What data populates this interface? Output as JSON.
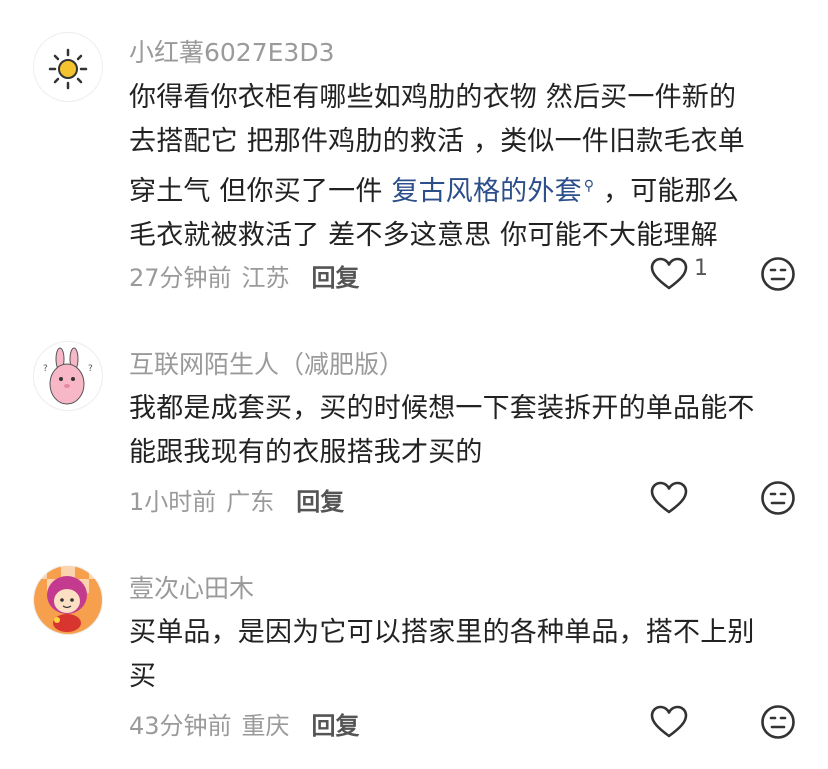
{
  "comments": [
    {
      "username": "小红薯6027E3D3",
      "avatar_icon": "sun-icon",
      "lines": [
        "你得看你衣柜有哪些如鸡肋的衣物  然后买一件新的",
        "去搭配它  把那件鸡肋的救活  ，类似一件旧款毛衣单"
      ],
      "line3_prefix": "穿土气  但你买了一件 ",
      "line3_link": "复古风格的外套",
      "line3_suffix": "  ，可能那么",
      "line4": "毛衣就被救活了  差不多这意思  你可能不大能理解",
      "time": "27分钟前",
      "location": "江苏",
      "reply": "回复",
      "likes": "1"
    },
    {
      "username": "互联网陌生人（减肥版）",
      "avatar_icon": "pink-bunny-avatar",
      "lines": [
        "我都是成套买，买的时候想一下套装拆开的单品能不",
        "能跟我现有的衣服搭我才买的"
      ],
      "time": "1小时前",
      "location": "广东",
      "reply": "回复"
    },
    {
      "username": "壹次心田木",
      "avatar_icon": "cartoon-girl-avatar",
      "lines": [
        "买单品，是因为它可以搭家里的各种单品，搭不上别",
        "买"
      ],
      "time": "43分钟前",
      "location": "重庆",
      "reply": "回复"
    }
  ],
  "colors": {
    "username": "#9a9a9a",
    "text": "#222222",
    "link": "#2c4e8a",
    "meta": "#9a9a9a"
  }
}
